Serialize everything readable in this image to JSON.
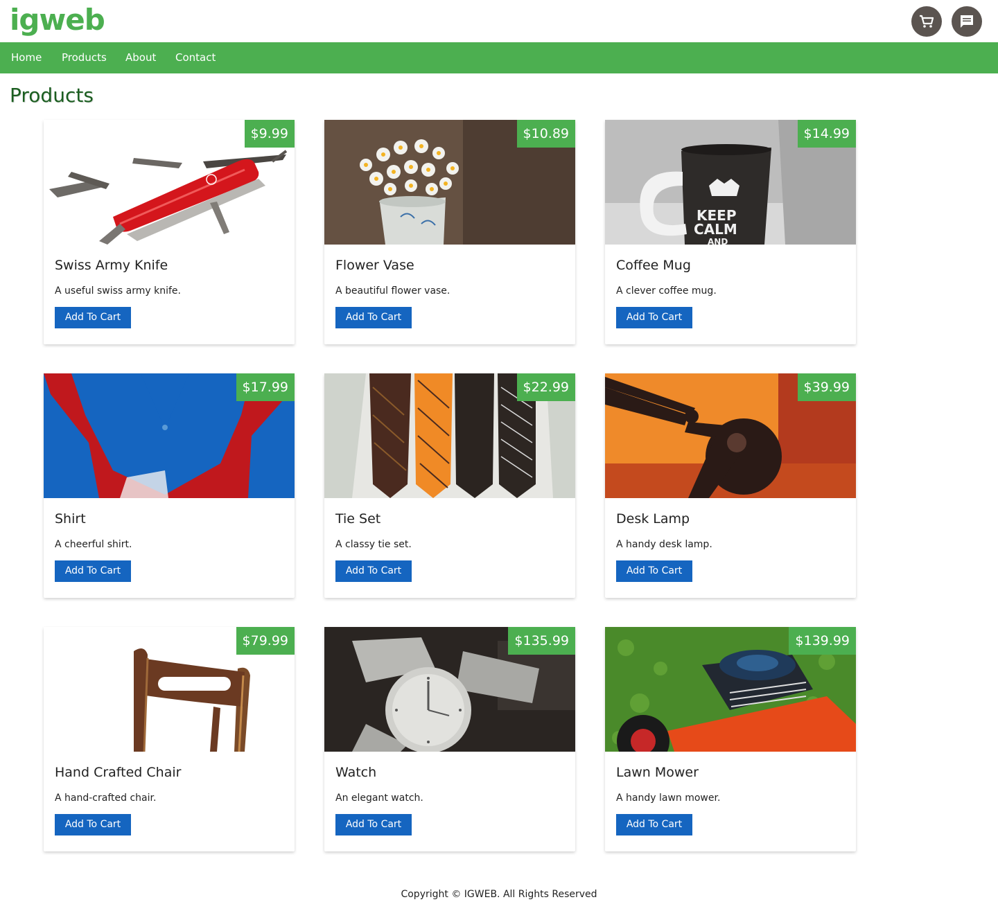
{
  "header": {
    "logo": "igweb",
    "cart_icon": "cart-icon",
    "chat_icon": "chat-icon"
  },
  "nav": {
    "items": [
      {
        "label": "Home"
      },
      {
        "label": "Products"
      },
      {
        "label": "About"
      },
      {
        "label": "Contact"
      }
    ]
  },
  "main": {
    "title": "Products",
    "products": [
      {
        "name": "Swiss Army Knife",
        "description": "A useful swiss army knife.",
        "price": "$9.99",
        "button": "Add To Cart",
        "image": "swiss-army-knife-image"
      },
      {
        "name": "Flower Vase",
        "description": "A beautiful flower vase.",
        "price": "$10.89",
        "button": "Add To Cart",
        "image": "flower-vase-image"
      },
      {
        "name": "Coffee Mug",
        "description": "A clever coffee mug.",
        "price": "$14.99",
        "button": "Add To Cart",
        "image": "coffee-mug-image"
      },
      {
        "name": "Shirt",
        "description": "A cheerful shirt.",
        "price": "$17.99",
        "button": "Add To Cart",
        "image": "shirt-image"
      },
      {
        "name": "Tie Set",
        "description": "A classy tie set.",
        "price": "$22.99",
        "button": "Add To Cart",
        "image": "tie-set-image"
      },
      {
        "name": "Desk Lamp",
        "description": "A handy desk lamp.",
        "price": "$39.99",
        "button": "Add To Cart",
        "image": "desk-lamp-image"
      },
      {
        "name": "Hand Crafted Chair",
        "description": "A hand-crafted chair.",
        "price": "$79.99",
        "button": "Add To Cart",
        "image": "chair-image"
      },
      {
        "name": "Watch",
        "description": "An elegant watch.",
        "price": "$135.99",
        "button": "Add To Cart",
        "image": "watch-image"
      },
      {
        "name": "Lawn Mower",
        "description": "A handy lawn mower.",
        "price": "$139.99",
        "button": "Add To Cart",
        "image": "lawn-mower-image"
      }
    ]
  },
  "footer": {
    "copyright": "Copyright © IGWEB. All Rights Reserved"
  },
  "colors": {
    "brand_green": "#4caf50",
    "button_blue": "#1565c0",
    "title_green": "#1b5e20"
  }
}
